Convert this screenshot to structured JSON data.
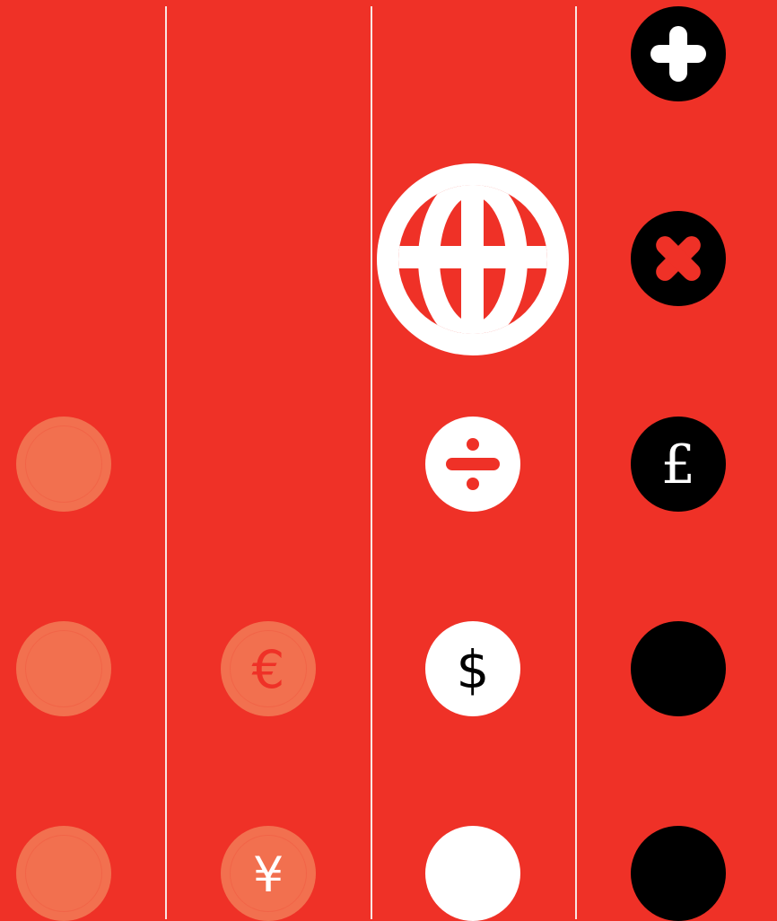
{
  "palette": {
    "background": "#ef3127",
    "muted_circle": "#f2704f",
    "white_circle": "#ffffff",
    "black_circle": "#000000",
    "divider": "#f9e6e3"
  },
  "icons": {
    "plus": "plus-icon",
    "close": "close-icon",
    "globe": "globe-icon",
    "divide": "divide-icon",
    "pound": "pound-icon",
    "dollar": "dollar-icon",
    "euro": "euro-icon",
    "yen": "yen-icon"
  },
  "symbols": {
    "euro": "€",
    "dollar": "$",
    "pound": "£",
    "yen": "¥"
  }
}
